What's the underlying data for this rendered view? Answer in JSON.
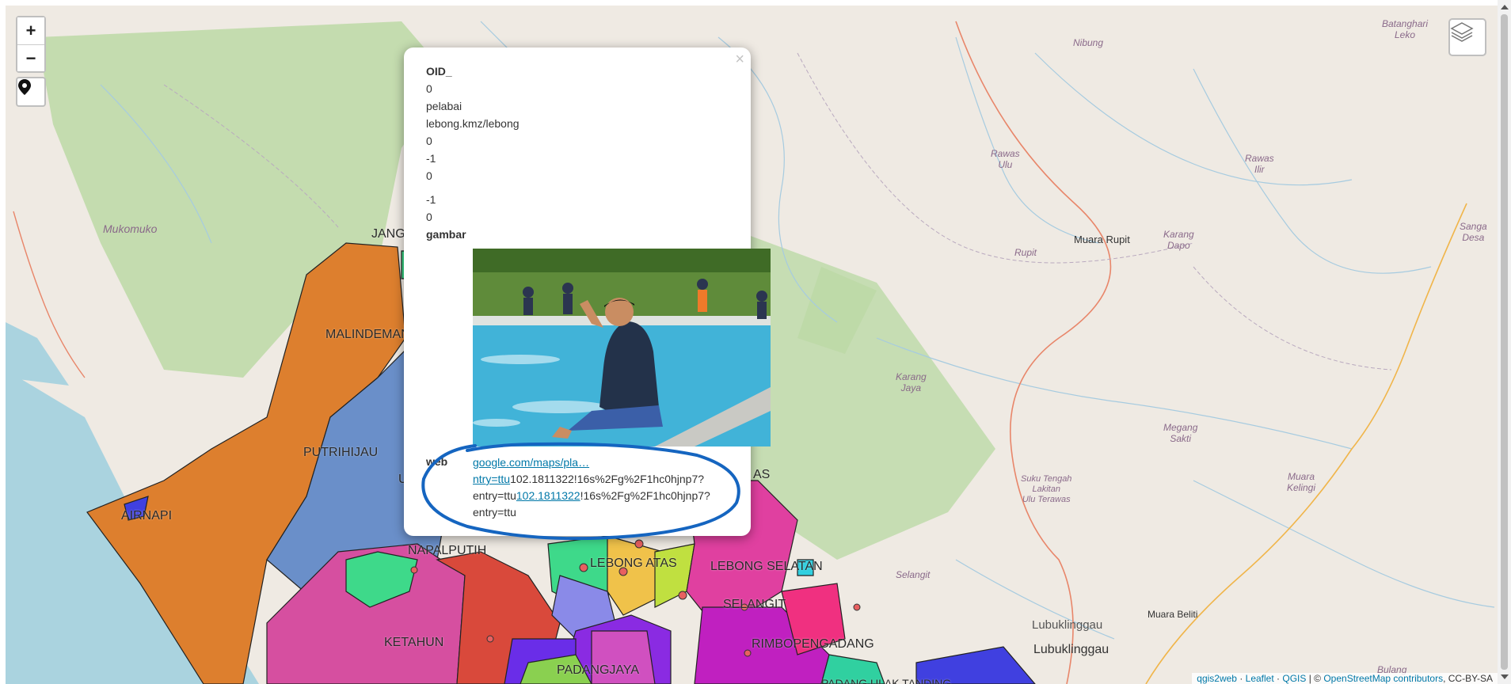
{
  "map_controls": {
    "zoom_in": "+",
    "zoom_out": "−"
  },
  "region_labels": {
    "malindeman": "MALINDEMAN",
    "putrihijau": "PUTRIHIJAU",
    "airnapi": "AIRNAPI",
    "napalputih": "NAPALPUTIH",
    "ketahun": "KETAHUN",
    "padangjaya": "PADANGJAYA",
    "lebong_atas": "LEBONG ATAS",
    "lebong_selatan": "LEBONG SELATAN",
    "selangit": "SELANGIT",
    "rimbopengadang": "RIMBOPENGADANG",
    "jang": "JANG",
    "as": "AS",
    "u": "U",
    "padang_ulak": "PADANG ULAK TANDING"
  },
  "place_labels": {
    "mukomuko": "Mukomuko",
    "nibung": "Nibung",
    "batanghari_leko": "Batanghari\nLeko",
    "rawas_ulu": "Rawas\nUlu",
    "rawas_ilir": "Rawas\nIlir",
    "rupit": "Rupit",
    "karang_dapo": "Karang\nDapo",
    "sanga_desa": "Sanga\nDesa",
    "karang_jaya": "Karang\nJaya",
    "megang_sakti": "Megang\nSakti",
    "suku_tengah": "Suku Tengah\nLakitan\nUlu Terawas",
    "muara_kelingi": "Muara\nKelingi",
    "selangit_town": "Selangit",
    "bulang": "Bulang"
  },
  "town_labels": {
    "muara_rupit": "Muara Rupit",
    "muara_beliti": "Muara Beliti",
    "lubuklinggau_small": "Lubuklinggau",
    "lubuklinggau": "Lubuklinggau"
  },
  "popup": {
    "close": "×",
    "oid_key": "OID_",
    "rows": [
      "0",
      "pelabai",
      "lebong.kmz/lebong",
      "0",
      "-1",
      "0",
      "-1",
      "0"
    ],
    "gambar_key": "gambar",
    "web_key": "web",
    "web_link1": "google.com/maps/pla…",
    "web_link2": "ntry=ttu",
    "web_text1": "102.1811322!16s%2Fg%2F1hc0hjnp7?",
    "web_text2": "entry=ttu",
    "web_link3": "102.1811322",
    "web_text3": "!16s%2Fg%2F1hc0hjnp7?",
    "web_text4": "entry=ttu"
  },
  "attribution": {
    "qgis2web": "qgis2web",
    "sep1": " · ",
    "leaflet": "Leaflet",
    "sep2": " · ",
    "qgis": "QGIS",
    "sep3": " | © ",
    "osm": "OpenStreetMap contributors",
    "license": ", CC-BY-SA"
  },
  "colors": {
    "map_bg": "#efeae3",
    "forest": "#bcd9a6",
    "sea": "#aad3df",
    "orange_region": "#dd7f2e",
    "blue_region": "#6a8fc9",
    "annotation": "#1565c0"
  }
}
